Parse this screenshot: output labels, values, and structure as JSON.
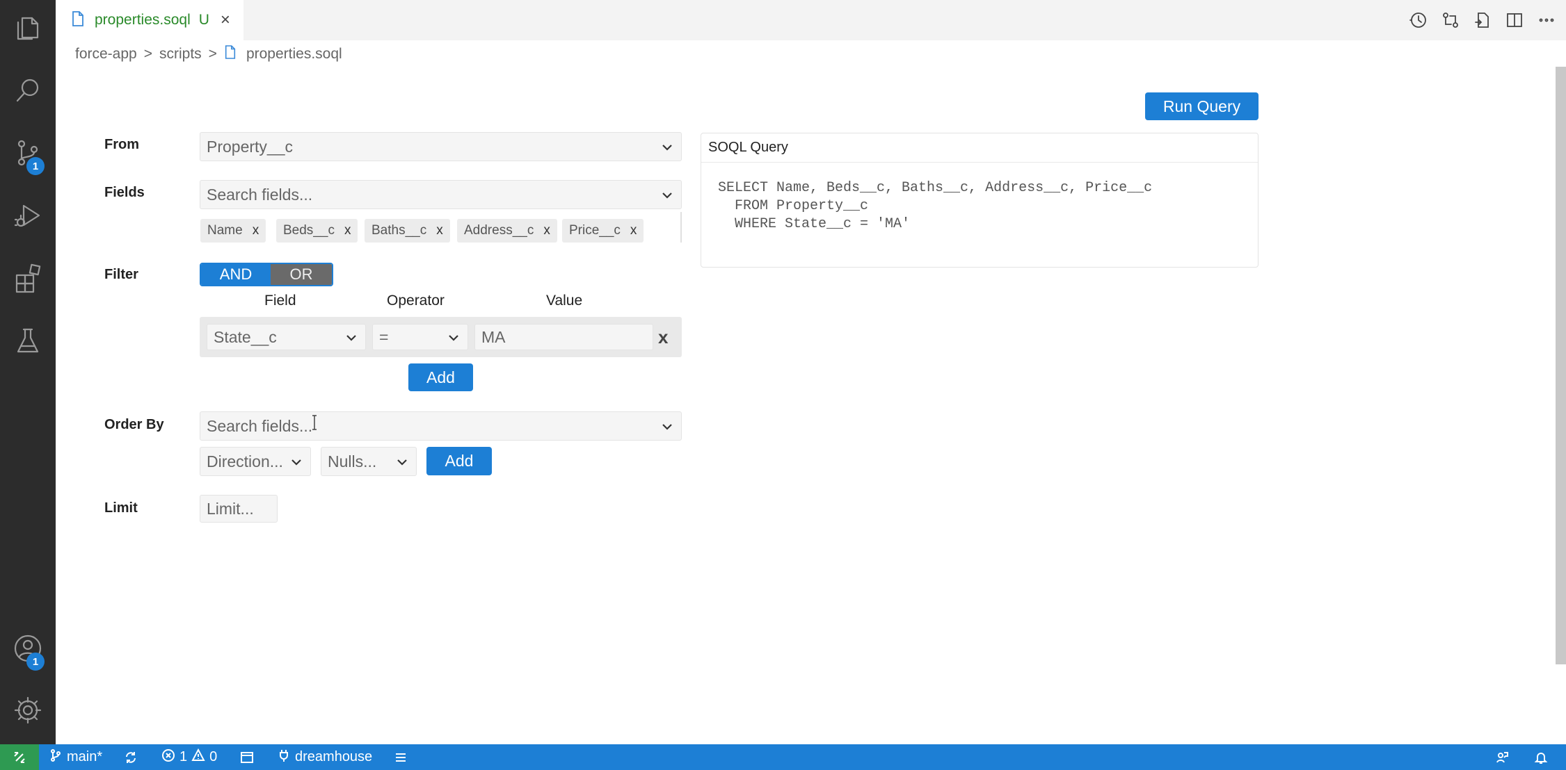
{
  "tab": {
    "title": "properties.soql",
    "modified": "U",
    "close": "×"
  },
  "breadcrumb": {
    "items": [
      "force-app",
      "scripts",
      "properties.soql"
    ],
    "sep": ">"
  },
  "activity": {
    "source_control_badge": "1",
    "accounts_badge": "1"
  },
  "builder": {
    "from": {
      "label": "From",
      "value": "Property__c"
    },
    "fields": {
      "label": "Fields",
      "placeholder": "Search fields...",
      "selected": [
        "Name",
        "Beds__c",
        "Baths__c",
        "Address__c",
        "Price__c"
      ],
      "remove_glyph": "x"
    },
    "filter": {
      "label": "Filter",
      "and_label": "AND",
      "or_label": "OR",
      "col_field": "Field",
      "col_operator": "Operator",
      "col_value": "Value",
      "row": {
        "field": "State__c",
        "operator": "=",
        "value": "MA",
        "remove": "x"
      },
      "add_label": "Add"
    },
    "order_by": {
      "label": "Order By",
      "placeholder": "Search fields...",
      "direction_placeholder": "Direction...",
      "nulls_placeholder": "Nulls...",
      "add_label": "Add"
    },
    "limit": {
      "label": "Limit",
      "placeholder": "Limit..."
    }
  },
  "run_query_label": "Run Query",
  "soql": {
    "title": "SOQL Query",
    "line1": "SELECT Name, Beds__c, Baths__c, Address__c, Price__c",
    "line2": "  FROM Property__c",
    "line3": "  WHERE State__c = 'MA'"
  },
  "status": {
    "branch": "main*",
    "errors": "1",
    "warnings": "0",
    "org": "dreamhouse"
  },
  "colors": {
    "accent": "#1d7fd5",
    "remote": "#2e9a52",
    "activity_bg": "#2c2c2c",
    "tab_text": "#2a8a2a"
  }
}
